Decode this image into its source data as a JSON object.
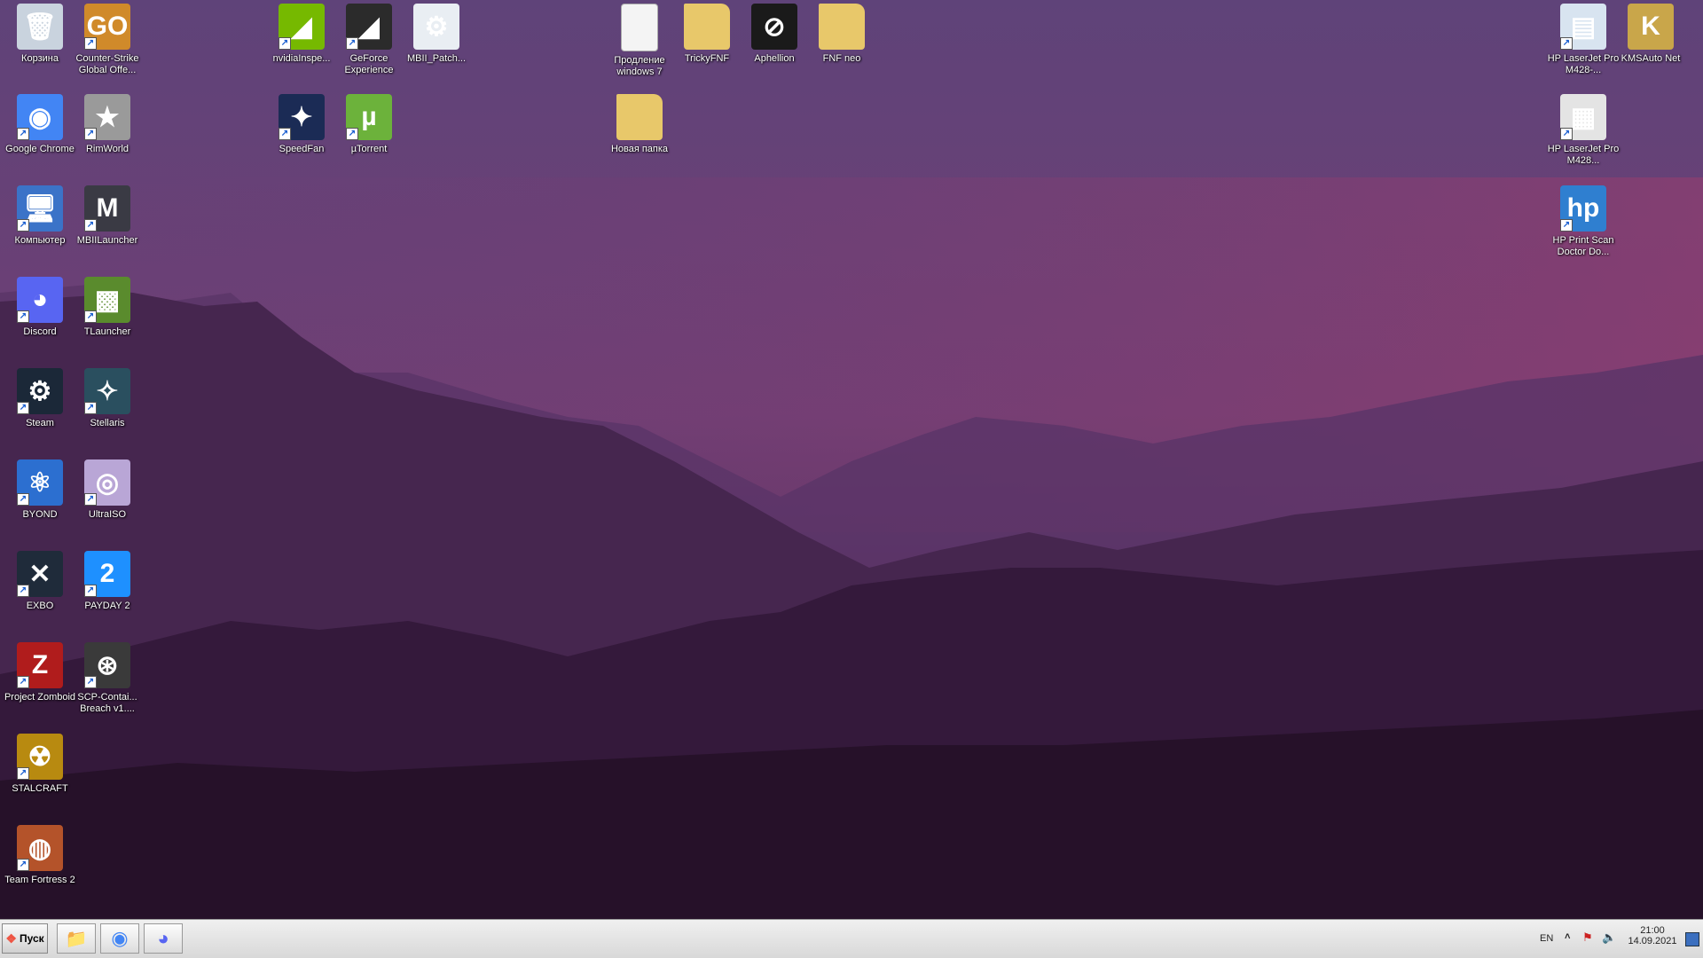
{
  "desktop": {
    "icons": [
      {
        "label": "Корзина",
        "glyph": "🗑",
        "bg": "#c9d3de",
        "icon": "recycle-bin-icon",
        "shortcut": false
      },
      {
        "label": "Counter-Strike Global Offe...",
        "glyph": "GO",
        "bg": "#d08a2a",
        "icon": "csgo-icon",
        "shortcut": true
      },
      {
        "label": "nvidiaInspe...",
        "glyph": "◢",
        "bg": "#76b900",
        "icon": "nvidia-inspector-icon",
        "shortcut": true
      },
      {
        "label": "GeForce Experience",
        "glyph": "◢",
        "bg": "#2b2b2b",
        "icon": "geforce-experience-icon",
        "shortcut": true
      },
      {
        "label": "MBII_Patch...",
        "glyph": "⚙",
        "bg": "#e9eef3",
        "icon": "mbii-patcher-icon",
        "shortcut": false
      },
      {
        "label": "Продление windows 7",
        "glyph": "",
        "bg": "#f4f4f4",
        "icon": "text-document-icon",
        "shortcut": false
      },
      {
        "label": "TrickyFNF",
        "glyph": "",
        "bg": "#e8c86a",
        "icon": "folder-icon",
        "shortcut": false
      },
      {
        "label": "Aphellion",
        "glyph": "⊘",
        "bg": "#1a1a1a",
        "icon": "aphellion-icon",
        "shortcut": false
      },
      {
        "label": "FNF neo",
        "glyph": "",
        "bg": "#e8c86a",
        "icon": "folder-icon",
        "shortcut": false
      },
      {
        "label": "HP LaserJet Pro M428-...",
        "glyph": "▤",
        "bg": "#d8e4f0",
        "icon": "scanner-icon",
        "shortcut": true
      },
      {
        "label": "KMSAuto Net",
        "glyph": "K",
        "bg": "#c9a64a",
        "icon": "kmsauto-icon",
        "shortcut": false
      },
      {
        "label": "Google Chrome",
        "glyph": "◉",
        "bg": "#4285f4",
        "icon": "chrome-icon",
        "shortcut": true
      },
      {
        "label": "RimWorld",
        "glyph": "★",
        "bg": "#9a9a9a",
        "icon": "rimworld-icon",
        "shortcut": true
      },
      {
        "label": "SpeedFan",
        "glyph": "✦",
        "bg": "#1b2b55",
        "icon": "speedfan-icon",
        "shortcut": true
      },
      {
        "label": "µTorrent",
        "glyph": "µ",
        "bg": "#6cb23b",
        "icon": "utorrent-icon",
        "shortcut": true
      },
      {
        "label": "Новая папка",
        "glyph": "",
        "bg": "#e8c86a",
        "icon": "folder-icon",
        "shortcut": false
      },
      {
        "label": "HP LaserJet Pro M428...",
        "glyph": "▦",
        "bg": "#e4e4e4",
        "icon": "printer-icon",
        "shortcut": true
      },
      {
        "label": "Компьютер",
        "glyph": "🖥",
        "bg": "#3b73c8",
        "icon": "computer-icon",
        "shortcut": true
      },
      {
        "label": "MBIILauncher",
        "glyph": "M",
        "bg": "#3a3a44",
        "icon": "mbii-launcher-icon",
        "shortcut": true
      },
      {
        "label": "HP Print Scan Doctor Do...",
        "glyph": "hp",
        "bg": "#2f7fd0",
        "icon": "hp-print-scan-doctor-icon",
        "shortcut": true
      },
      {
        "label": "Discord",
        "glyph": "◕",
        "bg": "#5865f2",
        "icon": "discord-icon",
        "shortcut": true
      },
      {
        "label": "TLauncher",
        "glyph": "▩",
        "bg": "#5a8b2d",
        "icon": "tlauncher-icon",
        "shortcut": true
      },
      {
        "label": "Steam",
        "glyph": "⚙",
        "bg": "#1b2838",
        "icon": "steam-icon",
        "shortcut": true
      },
      {
        "label": "Stellaris",
        "glyph": "✧",
        "bg": "#2a4f5f",
        "icon": "stellaris-icon",
        "shortcut": true
      },
      {
        "label": "BYOND",
        "glyph": "⚛",
        "bg": "#2c6fd0",
        "icon": "byond-icon",
        "shortcut": true
      },
      {
        "label": "UltraISO",
        "glyph": "◎",
        "bg": "#b9a6d6",
        "icon": "ultraiso-icon",
        "shortcut": true
      },
      {
        "label": "EXBO",
        "glyph": "✕",
        "bg": "#1f2b3a",
        "icon": "exbo-icon",
        "shortcut": true
      },
      {
        "label": "PAYDAY 2",
        "glyph": "2",
        "bg": "#1e90ff",
        "icon": "payday2-icon",
        "shortcut": true
      },
      {
        "label": "Project Zomboid",
        "glyph": "Z",
        "bg": "#b01c1c",
        "icon": "project-zomboid-icon",
        "shortcut": true
      },
      {
        "label": "SCP-Contai... Breach v1....",
        "glyph": "⊛",
        "bg": "#3a3a3a",
        "icon": "scp-icon",
        "shortcut": true
      },
      {
        "label": "STALCRAFT",
        "glyph": "☢",
        "bg": "#b88a10",
        "icon": "stalcraft-icon",
        "shortcut": true
      },
      {
        "label": "Team Fortress 2",
        "glyph": "◍",
        "bg": "#b4532a",
        "icon": "tf2-icon",
        "shortcut": true
      }
    ]
  },
  "taskbar": {
    "start_label": "Пуск",
    "pinned": [
      {
        "icon": "explorer-icon",
        "glyph": "📁"
      },
      {
        "icon": "chrome-icon",
        "glyph": "◉"
      },
      {
        "icon": "discord-icon",
        "glyph": "◕"
      }
    ],
    "lang": "EN",
    "time": "21:00",
    "date": "14.09.2021",
    "tray_arrow": "˄"
  }
}
